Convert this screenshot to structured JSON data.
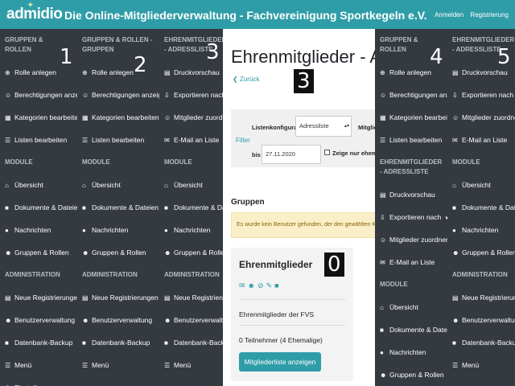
{
  "header": {
    "logo": "admidio",
    "title": "Die Online-Mitgliederverwaltung - Fachvereinigung Sportkegeln e.V.",
    "login": "Anmelden",
    "register": "Registrierung"
  },
  "col1": {
    "number": "1",
    "s1": "GRUPPEN & ROLLEN",
    "items_a": [
      {
        "icon": "plus-circle-icon",
        "glyph": "⊕",
        "label": "Rolle anlegen"
      },
      {
        "icon": "user-key-icon",
        "glyph": "☺",
        "label": "Berechtigungen anzeigen"
      },
      {
        "icon": "grid-icon",
        "glyph": "▦",
        "label": "Kategorien bearbeiten"
      },
      {
        "icon": "list-icon",
        "glyph": "☰",
        "label": "Listen bearbeiten"
      }
    ],
    "s2": "MODULE",
    "items_b": [
      {
        "icon": "home-icon",
        "glyph": "⌂",
        "label": "Übersicht"
      },
      {
        "icon": "file-icon",
        "glyph": "■",
        "label": "Dokumente & Dateien"
      },
      {
        "icon": "comments-icon",
        "glyph": "●",
        "label": "Nachrichten"
      },
      {
        "icon": "users-icon",
        "glyph": "☻",
        "label": "Gruppen & Rollen"
      }
    ],
    "s3": "ADMINISTRATION",
    "items_c": [
      {
        "icon": "address-card-icon",
        "glyph": "▤",
        "label": "Neue Registrierungen"
      },
      {
        "icon": "users-cog-icon",
        "glyph": "☻",
        "label": "Benutzerverwaltung"
      },
      {
        "icon": "database-icon",
        "glyph": "■",
        "label": "Datenbank-Backup"
      },
      {
        "icon": "menu-icon",
        "glyph": "☰",
        "label": "Menü"
      },
      {
        "icon": "cog-icon",
        "glyph": "⚙",
        "label": "Einstellungen"
      }
    ]
  },
  "col2": {
    "number": "2",
    "s1": "GRUPPEN & ROLLEN - GRUPPEN",
    "items_a": [
      {
        "icon": "plus-circle-icon",
        "glyph": "⊕",
        "label": "Rolle anlegen"
      },
      {
        "icon": "user-key-icon",
        "glyph": "☺",
        "label": "Berechtigungen anzeigen"
      },
      {
        "icon": "grid-icon",
        "glyph": "▦",
        "label": "Kategorien bearbeiten"
      },
      {
        "icon": "list-icon",
        "glyph": "☰",
        "label": "Listen bearbeiten"
      }
    ],
    "s2": "MODULE",
    "items_b": [
      {
        "icon": "home-icon",
        "glyph": "⌂",
        "label": "Übersicht"
      },
      {
        "icon": "file-icon",
        "glyph": "■",
        "label": "Dokumente & Dateien"
      },
      {
        "icon": "comments-icon",
        "glyph": "●",
        "label": "Nachrichten"
      },
      {
        "icon": "users-icon",
        "glyph": "☻",
        "label": "Gruppen & Rollen"
      }
    ],
    "s3": "ADMINISTRATION",
    "items_c": [
      {
        "icon": "address-card-icon",
        "glyph": "▤",
        "label": "Neue Registrierungen"
      },
      {
        "icon": "users-cog-icon",
        "glyph": "☻",
        "label": "Benutzerverwaltung"
      },
      {
        "icon": "database-icon",
        "glyph": "■",
        "label": "Datenbank-Backup"
      },
      {
        "icon": "menu-icon",
        "glyph": "☰",
        "label": "Menü"
      }
    ]
  },
  "col3": {
    "number": "3",
    "s1": "EHRENMITGLIEDER - ADRESSLISTE",
    "items_a": [
      {
        "icon": "print-icon",
        "glyph": "▤",
        "label": "Druckvorschau"
      },
      {
        "icon": "export-icon",
        "glyph": "⇩",
        "label": "Exportieren nach"
      },
      {
        "icon": "user-plus-icon",
        "glyph": "☺",
        "label": "Mitglieder zuordnen"
      },
      {
        "icon": "envelope-icon",
        "glyph": "✉",
        "label": "E-Mail an Liste"
      }
    ],
    "s2": "MODULE",
    "items_b": [
      {
        "icon": "home-icon",
        "glyph": "⌂",
        "label": "Übersicht"
      },
      {
        "icon": "file-icon",
        "glyph": "■",
        "label": "Dokumente & Dateien"
      },
      {
        "icon": "comments-icon",
        "glyph": "●",
        "label": "Nachrichten"
      },
      {
        "icon": "users-icon",
        "glyph": "☻",
        "label": "Gruppen & Rollen"
      }
    ],
    "s3": "ADMINISTRATION",
    "items_c": [
      {
        "icon": "address-card-icon",
        "glyph": "▤",
        "label": "Neue Registrierungen"
      },
      {
        "icon": "users-cog-icon",
        "glyph": "☻",
        "label": "Benutzerverwaltung"
      },
      {
        "icon": "database-icon",
        "glyph": "■",
        "label": "Datenbank-Backup"
      },
      {
        "icon": "menu-icon",
        "glyph": "☰",
        "label": "Menü"
      }
    ]
  },
  "col4": {
    "number": "4",
    "s1": "GRUPPEN & ROLLEN",
    "items_a": [
      {
        "icon": "plus-circle-icon",
        "glyph": "⊕",
        "label": "Rolle anlegen"
      },
      {
        "icon": "user-key-icon",
        "glyph": "☺",
        "label": "Berechtigungen anzeigen"
      },
      {
        "icon": "grid-icon",
        "glyph": "▦",
        "label": "Kategorien bearbeiten"
      },
      {
        "icon": "list-icon",
        "glyph": "☰",
        "label": "Listen bearbeiten"
      }
    ],
    "s2": "EHRENMITGLIEDER - ADRESSLISTE",
    "items_b": [
      {
        "icon": "print-icon",
        "glyph": "▤",
        "label": "Druckvorschau"
      },
      {
        "icon": "export-icon",
        "glyph": "⇩",
        "label": "Exportieren nach"
      },
      {
        "icon": "user-plus-icon",
        "glyph": "☺",
        "label": "Mitglieder zuordnen"
      },
      {
        "icon": "envelope-icon",
        "glyph": "✉",
        "label": "E-Mail an Liste"
      }
    ],
    "s3": "MODULE",
    "items_c": [
      {
        "icon": "home-icon",
        "glyph": "⌂",
        "label": "Übersicht"
      },
      {
        "icon": "file-icon",
        "glyph": "■",
        "label": "Dokumente & Dateien"
      },
      {
        "icon": "comments-icon",
        "glyph": "●",
        "label": "Nachrichten"
      },
      {
        "icon": "users-icon",
        "glyph": "☻",
        "label": "Gruppen & Rollen"
      }
    ]
  },
  "col5": {
    "number": "5",
    "s1": "EHRENMITGLIEDER - ADRESSLISTE",
    "items_a": [
      {
        "icon": "print-icon",
        "glyph": "▤",
        "label": "Druckvorschau"
      },
      {
        "icon": "export-icon",
        "glyph": "⇩",
        "label": "Exportieren nach"
      },
      {
        "icon": "user-plus-icon",
        "glyph": "☺",
        "label": "Mitglieder zuordnen"
      },
      {
        "icon": "envelope-icon",
        "glyph": "✉",
        "label": "E-Mail an Liste"
      }
    ],
    "s2": "MODULE",
    "items_b": [
      {
        "icon": "home-icon",
        "glyph": "⌂",
        "label": "Übersicht"
      },
      {
        "icon": "file-icon",
        "glyph": "■",
        "label": "Dokumente & Dateien"
      },
      {
        "icon": "comments-icon",
        "glyph": "●",
        "label": "Nachrichten"
      },
      {
        "icon": "users-icon",
        "glyph": "☻",
        "label": "Gruppen & Rollen"
      }
    ],
    "s3": "ADMINISTRATION",
    "items_c": [
      {
        "icon": "address-card-icon",
        "glyph": "▤",
        "label": "Neue Registrierungen"
      },
      {
        "icon": "users-cog-icon",
        "glyph": "☻",
        "label": "Benutzerverwaltung"
      },
      {
        "icon": "database-icon",
        "glyph": "■",
        "label": "Datenbank-Backup"
      },
      {
        "icon": "menu-icon",
        "glyph": "☰",
        "label": "Menü"
      }
    ]
  },
  "main": {
    "number": "3",
    "title": "Ehrenmitglieder - Adressliste",
    "back": "Zurück",
    "filter_link": "Filter",
    "listconfig_label": "Listenkonfiguration",
    "listconfig_value": "Adressliste",
    "members_label": "Mitglieder",
    "until_label": "bis",
    "date_value": "27.11.2020",
    "former_label": "Zeige nur ehemalige Mitglieder",
    "groups_title": "Gruppen",
    "alert": "Es wurde kein Benutzer gefunden, der den gewählten Kriterien entspricht.",
    "card": {
      "number": "0",
      "title": "Ehrenmitglieder",
      "description": "Ehrenmitglieder der FVS",
      "members": "0 Teilnehmer  (4 Ehemalige)",
      "button": "Mitgliederliste anzeigen"
    }
  },
  "colors": {
    "accent": "#2f9da8",
    "sidebar": "#343a40",
    "alert_bg": "#fbefc8"
  }
}
